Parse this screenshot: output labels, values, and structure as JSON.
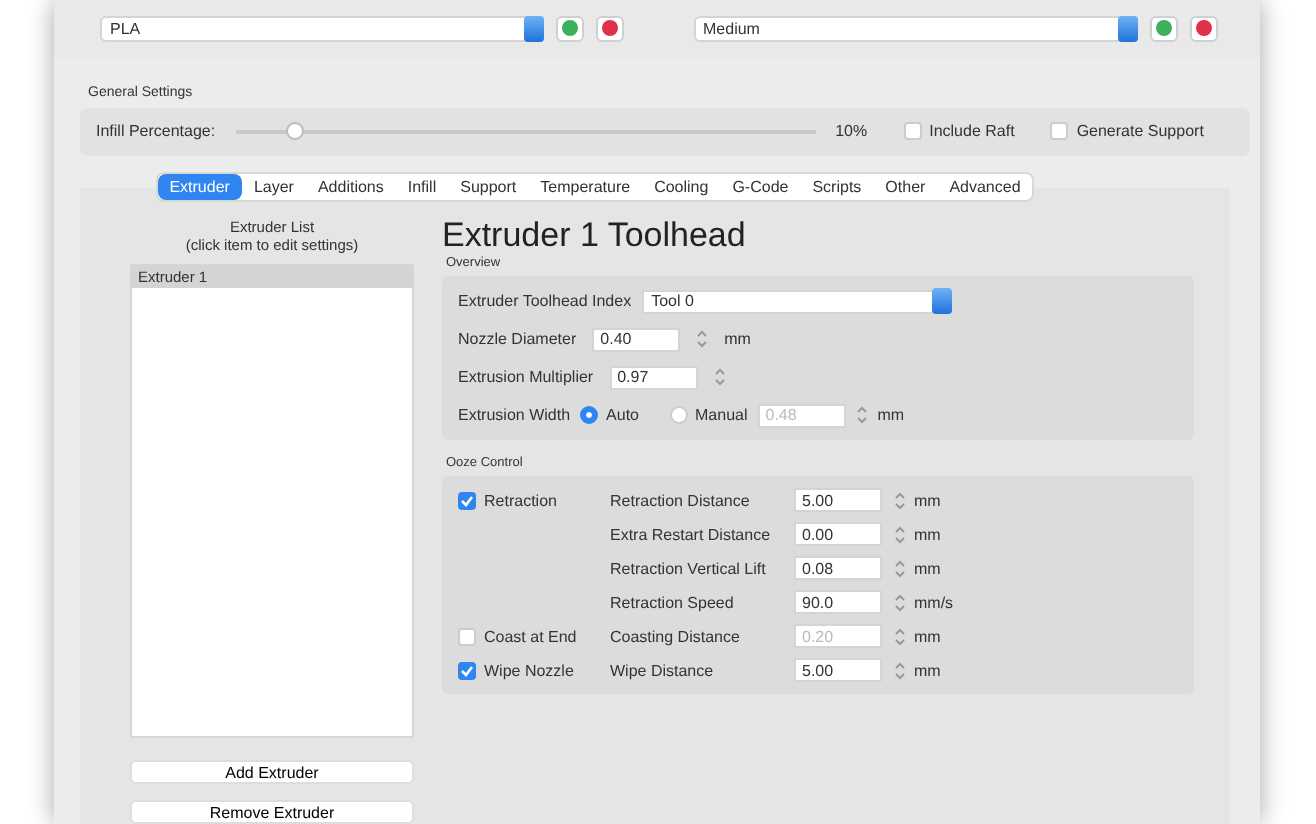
{
  "profiles": [
    {
      "value": "PLA"
    },
    {
      "value": "Medium"
    }
  ],
  "general_settings": {
    "title": "General Settings",
    "infill": {
      "label": "Infill Percentage:",
      "level": 0.1,
      "reading": "10%"
    },
    "options": [
      {
        "label": "Include Raft",
        "checked": false
      },
      {
        "label": "Generate Support",
        "checked": false
      }
    ]
  },
  "tabs": [
    {
      "label": "Extruder",
      "selected": true
    },
    {
      "label": "Layer",
      "selected": false
    },
    {
      "label": "Additions",
      "selected": false
    },
    {
      "label": "Infill",
      "selected": false
    },
    {
      "label": "Support",
      "selected": false
    },
    {
      "label": "Temperature",
      "selected": false
    },
    {
      "label": "Cooling",
      "selected": false
    },
    {
      "label": "G-Code",
      "selected": false
    },
    {
      "label": "Scripts",
      "selected": false
    },
    {
      "label": "Other",
      "selected": false
    },
    {
      "label": "Advanced",
      "selected": false
    }
  ],
  "extruder_list": {
    "heading": [
      "Extruder List",
      "(click item to edit settings)"
    ],
    "items": [
      {
        "label": "Extruder 1",
        "selected": true
      }
    ],
    "buttons": [
      "Add Extruder",
      "Remove Extruder"
    ]
  },
  "editor": {
    "title": "Extruder 1 Toolhead",
    "overview": {
      "title": "Overview",
      "rows": [
        {
          "kind": "select",
          "label": "Extruder Toolhead Index",
          "value": "Tool 0"
        },
        {
          "kind": "spin",
          "label": "Nozzle Diameter",
          "value": "0.40",
          "unit": "mm"
        },
        {
          "kind": "spin",
          "label": "Extrusion Multiplier",
          "value": "0.97"
        },
        {
          "kind": "radio",
          "label": "Extrusion Width",
          "options": [
            {
              "label": "Auto",
              "selected": true
            },
            {
              "label": "Manual",
              "selected": false
            }
          ],
          "value": "0.48",
          "disabled": true,
          "unit": "mm"
        }
      ]
    },
    "ooze": {
      "title": "Ooze Control",
      "rows": [
        {
          "toggle": {
            "label": "Retraction",
            "checked": true
          },
          "label": "Retraction Distance",
          "value": "5.00",
          "unit": "mm",
          "disabled": false
        },
        {
          "label": "Extra Restart Distance",
          "value": "0.00",
          "unit": "mm",
          "disabled": false
        },
        {
          "label": "Retraction Vertical Lift",
          "value": "0.08",
          "unit": "mm",
          "disabled": false
        },
        {
          "label": "Retraction Speed",
          "value": "90.0",
          "unit": "mm/s",
          "disabled": false
        },
        {
          "toggle": {
            "label": "Coast at End",
            "checked": false
          },
          "label": "Coasting Distance",
          "value": "0.20",
          "unit": "mm",
          "disabled": true
        },
        {
          "toggle": {
            "label": "Wipe Nozzle",
            "checked": true
          },
          "label": "Wipe Distance",
          "value": "5.00",
          "unit": "mm",
          "disabled": false
        }
      ]
    }
  }
}
